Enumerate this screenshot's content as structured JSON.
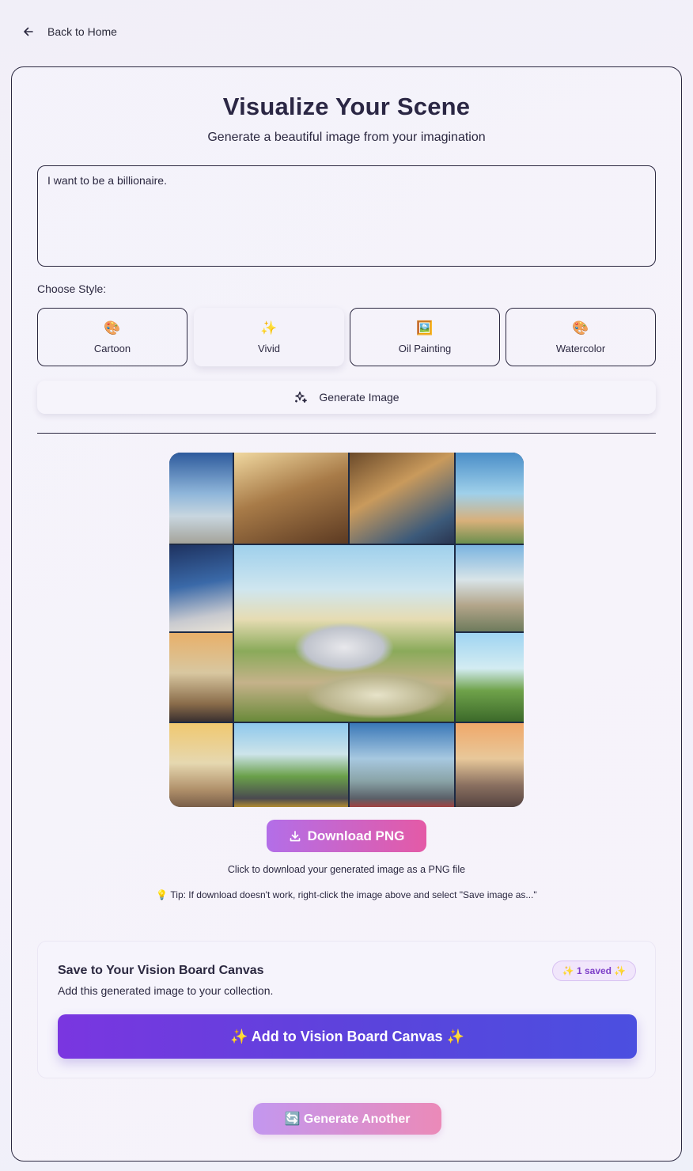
{
  "nav": {
    "back_label": "Back to Home",
    "back_icon": "arrow-left-icon"
  },
  "header": {
    "title": "Visualize Your Scene",
    "subtitle": "Generate a beautiful image from your imagination"
  },
  "prompt": {
    "value": "I want to be a billionaire."
  },
  "styles": {
    "label": "Choose Style:",
    "selected": "Vivid",
    "options": [
      {
        "emoji": "🎨",
        "label": "Cartoon"
      },
      {
        "emoji": "✨",
        "label": "Vivid"
      },
      {
        "emoji": "🖼️",
        "label": "Oil Painting"
      },
      {
        "emoji": "🎨",
        "label": "Watercolor"
      }
    ]
  },
  "generate": {
    "label": "Generate Image",
    "icon": "sparkles-icon"
  },
  "result": {
    "download_label": "Download PNG",
    "download_icon": "download-icon",
    "download_note": "Click to download your generated image as a PNG file",
    "tip": "💡 Tip: If download doesn't work, right-click the image above and select \"Save image as...\""
  },
  "vision_board": {
    "title": "Save to Your Vision Board Canvas",
    "description": "Add this generated image to your collection.",
    "saved_badge": "✨ 1 saved ✨",
    "add_label": "✨ Add to Vision Board Canvas ✨"
  },
  "generate_another": {
    "label": "🔄 Generate Another"
  },
  "colors": {
    "text": "#2b2840",
    "download_gradient": [
      "#b36ee8",
      "#e45aa6"
    ],
    "add_gradient": [
      "#7a36e0",
      "#4b4fe0"
    ],
    "badge_text": "#7d3ec8"
  }
}
